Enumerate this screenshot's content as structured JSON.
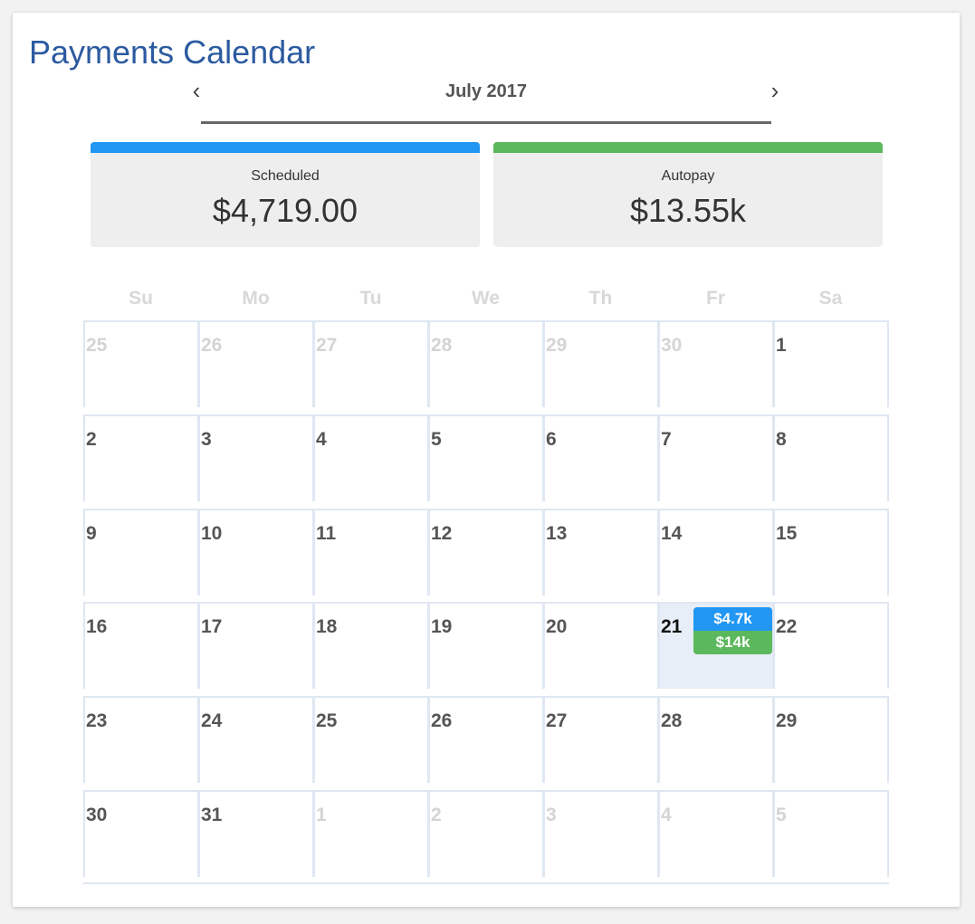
{
  "title": "Payments Calendar",
  "nav": {
    "month_label": "July 2017",
    "prev_icon": "‹",
    "next_icon": "›"
  },
  "colors": {
    "scheduled": "#2196f3",
    "autopay": "#5cb85c"
  },
  "summary": {
    "scheduled": {
      "label": "Scheduled",
      "amount": "$4,719.00"
    },
    "autopay": {
      "label": "Autopay",
      "amount": "$13.55k"
    }
  },
  "weekdays": [
    "Su",
    "Mo",
    "Tu",
    "We",
    "Th",
    "Fr",
    "Sa"
  ],
  "weeks": [
    [
      {
        "day": "25",
        "muted": true
      },
      {
        "day": "26",
        "muted": true
      },
      {
        "day": "27",
        "muted": true
      },
      {
        "day": "28",
        "muted": true
      },
      {
        "day": "29",
        "muted": true
      },
      {
        "day": "30",
        "muted": true
      },
      {
        "day": "1"
      }
    ],
    [
      {
        "day": "2"
      },
      {
        "day": "3"
      },
      {
        "day": "4"
      },
      {
        "day": "5"
      },
      {
        "day": "6"
      },
      {
        "day": "7"
      },
      {
        "day": "8"
      }
    ],
    [
      {
        "day": "9"
      },
      {
        "day": "10"
      },
      {
        "day": "11"
      },
      {
        "day": "12"
      },
      {
        "day": "13"
      },
      {
        "day": "14"
      },
      {
        "day": "15"
      }
    ],
    [
      {
        "day": "16"
      },
      {
        "day": "17"
      },
      {
        "day": "18"
      },
      {
        "day": "19"
      },
      {
        "day": "20"
      },
      {
        "day": "21",
        "today": true
      },
      {
        "day": "22"
      }
    ],
    [
      {
        "day": "23"
      },
      {
        "day": "24"
      },
      {
        "day": "25"
      },
      {
        "day": "26"
      },
      {
        "day": "27"
      },
      {
        "day": "28"
      },
      {
        "day": "29"
      }
    ],
    [
      {
        "day": "30"
      },
      {
        "day": "31"
      },
      {
        "day": "1",
        "muted": true
      },
      {
        "day": "2",
        "muted": true
      },
      {
        "day": "3",
        "muted": true
      },
      {
        "day": "4",
        "muted": true
      },
      {
        "day": "5",
        "muted": true
      }
    ]
  ],
  "events": {
    "scheduled_label": "$4.7k",
    "autopay_label": "$14k"
  }
}
